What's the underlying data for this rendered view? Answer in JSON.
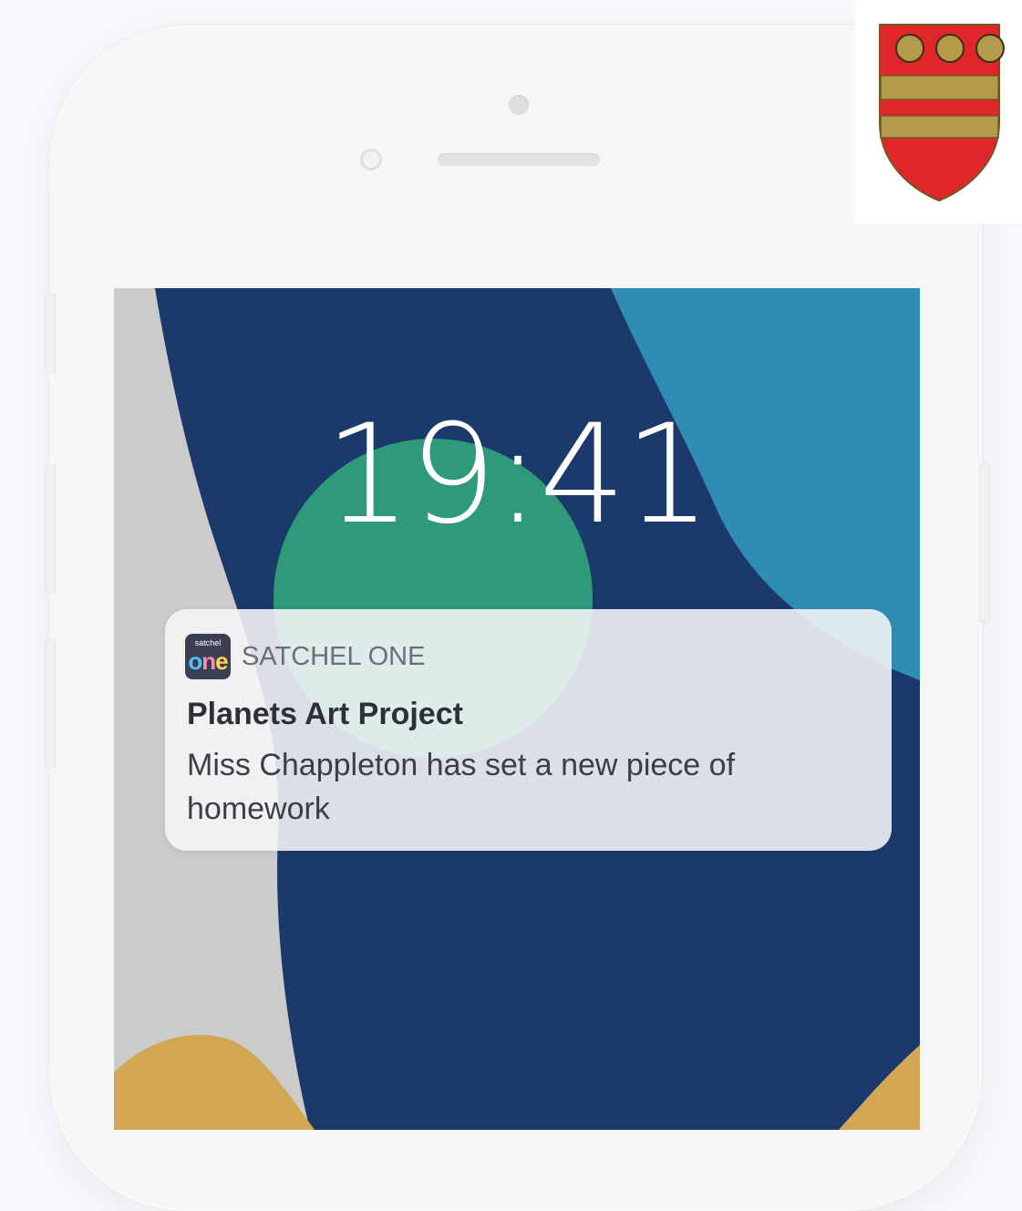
{
  "lock_screen": {
    "time": "19:41"
  },
  "notification": {
    "app_icon_small_text": "satchel",
    "app_icon_big_text": [
      "o",
      "n",
      "e"
    ],
    "app_name": "SATCHEL ONE",
    "title": "Planets Art Project",
    "body": "Miss Chappleton has set a new piece of homework"
  },
  "icons": {
    "app_icon": "satchel-one-app-icon",
    "logo": "shield-crest-icon"
  },
  "colors": {
    "wallpaper_navy": "#1b3a6b",
    "wallpaper_teal": "#2f8db3",
    "wallpaper_green": "#2e9a7a",
    "wallpaper_gold": "#d2a652",
    "wallpaper_grey": "#cbcbcb",
    "shield_red": "#e0262b",
    "shield_gold": "#b39b4b"
  }
}
